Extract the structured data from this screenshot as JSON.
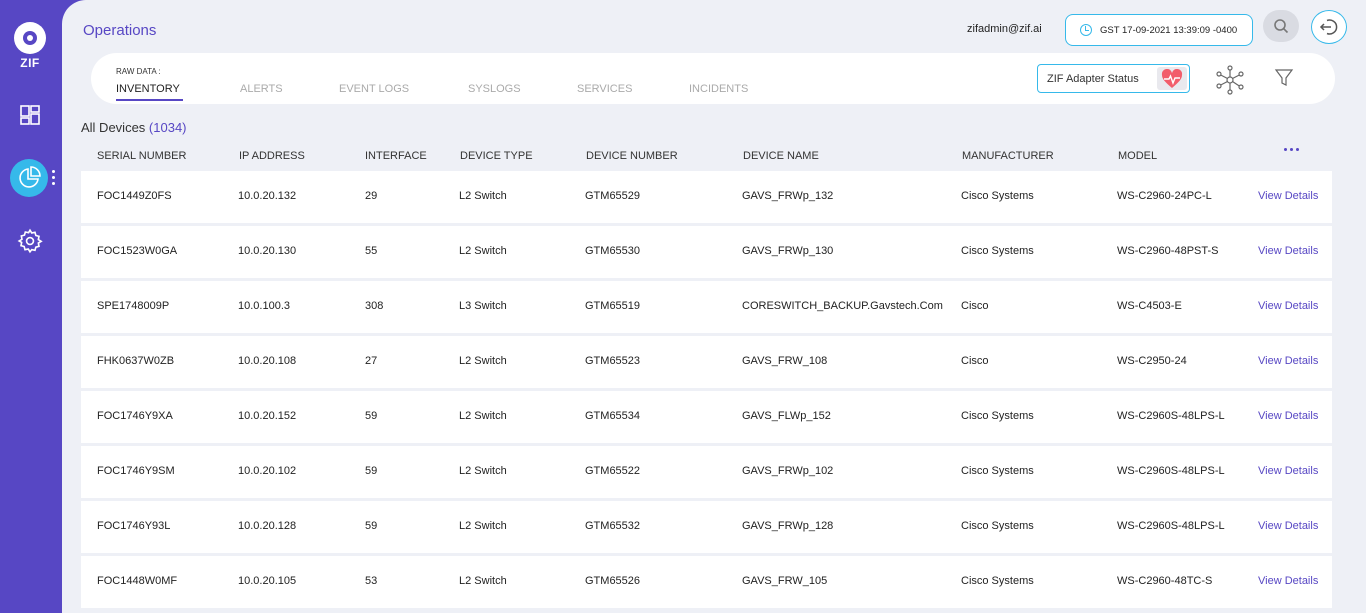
{
  "app": {
    "logo_text": "ZIF"
  },
  "header": {
    "page_title": "Operations",
    "user_email": "zifadmin@zif.ai",
    "datetime": "GST 17-09-2021 13:39:09 -0400"
  },
  "tabs": {
    "raw_label": "RAW DATA :",
    "items": [
      {
        "label": "INVENTORY",
        "active": true
      },
      {
        "label": "ALERTS",
        "active": false
      },
      {
        "label": "EVENT LOGS",
        "active": false
      },
      {
        "label": "SYSLOGS",
        "active": false
      },
      {
        "label": "SERVICES",
        "active": false
      },
      {
        "label": "INCIDENTS",
        "active": false
      }
    ],
    "adapter_status_label": "ZIF Adapter Status"
  },
  "devices": {
    "heading": "All Devices",
    "count": "(1034)",
    "columns": [
      "SERIAL NUMBER",
      "IP ADDRESS",
      "INTERFACE",
      "DEVICE TYPE",
      "DEVICE NUMBER",
      "DEVICE NAME",
      "MANUFACTURER",
      "MODEL"
    ],
    "action_label": "View Details",
    "rows": [
      [
        "FOC1449Z0FS",
        "10.0.20.132",
        "29",
        "L2 Switch",
        "GTM65529",
        "GAVS_FRWp_132",
        "Cisco Systems",
        "WS-C2960-24PC-L"
      ],
      [
        "FOC1523W0GA",
        "10.0.20.130",
        "55",
        "L2 Switch",
        "GTM65530",
        "GAVS_FRWp_130",
        "Cisco Systems",
        "WS-C2960-48PST-S"
      ],
      [
        "SPE1748009P",
        "10.0.100.3",
        "308",
        "L3 Switch",
        "GTM65519",
        "CORESWITCH_BACKUP.Gavstech.Com",
        "Cisco",
        "WS-C4503-E"
      ],
      [
        "FHK0637W0ZB",
        "10.0.20.108",
        "27",
        "L2 Switch",
        "GTM65523",
        "GAVS_FRW_108",
        "Cisco",
        "WS-C2950-24"
      ],
      [
        "FOC1746Y9XA",
        "10.0.20.152",
        "59",
        "L2 Switch",
        "GTM65534",
        "GAVS_FLWp_152",
        "Cisco Systems",
        "WS-C2960S-48LPS-L"
      ],
      [
        "FOC1746Y9SM",
        "10.0.20.102",
        "59",
        "L2 Switch",
        "GTM65522",
        "GAVS_FRWp_102",
        "Cisco Systems",
        "WS-C2960S-48LPS-L"
      ],
      [
        "FOC1746Y93L",
        "10.0.20.128",
        "59",
        "L2 Switch",
        "GTM65532",
        "GAVS_FRWp_128",
        "Cisco Systems",
        "WS-C2960S-48LPS-L"
      ],
      [
        "FOC1448W0MF",
        "10.0.20.105",
        "53",
        "L2 Switch",
        "GTM65526",
        "GAVS_FRW_105",
        "Cisco Systems",
        "WS-C2960-48TC-S"
      ]
    ]
  },
  "icons": {
    "sidebar": [
      "zif-logo-icon",
      "dashboard-icon",
      "pie-chart-icon",
      "settings-gear-icon"
    ],
    "header": [
      "clock-icon",
      "search-icon",
      "logout-icon"
    ],
    "toolbar": [
      "heart-pulse-icon",
      "network-topology-icon",
      "filter-icon",
      "more-options-icon"
    ]
  },
  "colors": {
    "primary": "#5747c4",
    "accent": "#36b9ea",
    "background": "#eef0f6",
    "heart": "#f25d6b"
  }
}
